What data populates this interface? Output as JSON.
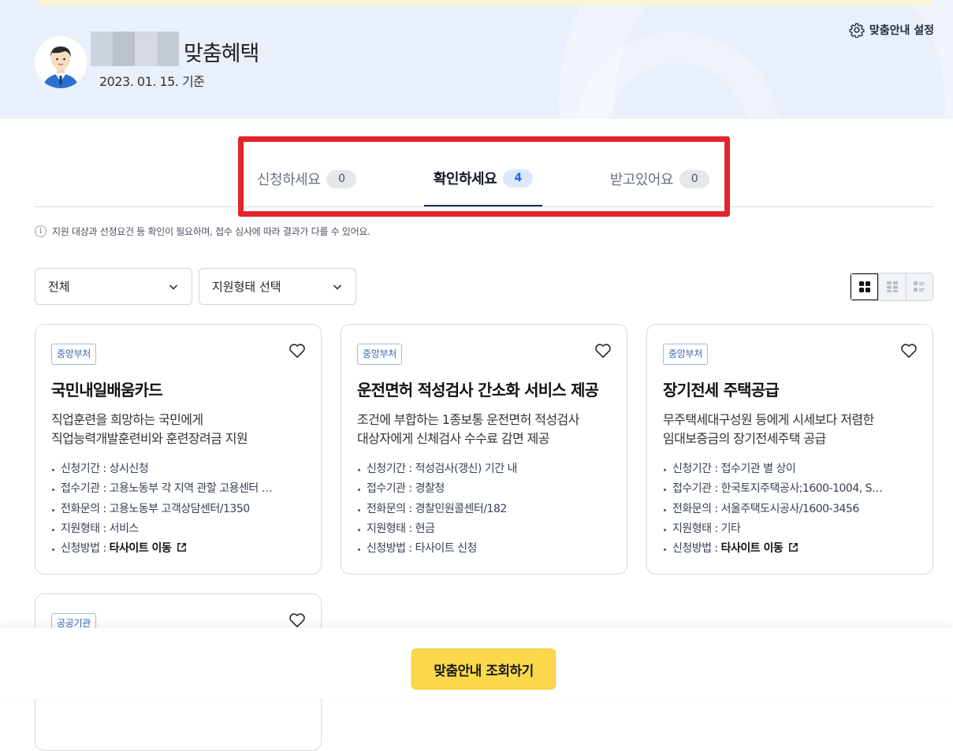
{
  "header": {
    "title": "맞춤혜택",
    "date": "2023. 01. 15. 기준",
    "settings_label": "맞춤안내 설정"
  },
  "tabs": [
    {
      "label": "신청하세요",
      "count": "0"
    },
    {
      "label": "확인하세요",
      "count": "4"
    },
    {
      "label": "받고있어요",
      "count": "0"
    }
  ],
  "active_tab": "확인하세요",
  "info_text": "지원 대상과 선정요건 등 확인이 필요하며, 접수 심사에 따라 결과가 다를 수 있어요.",
  "filters": {
    "category": "전체",
    "support_type": "지원형태 선택"
  },
  "view_modes": [
    "grid-4",
    "grid-list",
    "list"
  ],
  "cards": [
    {
      "badge": "중앙부처",
      "title": "국민내일배움카드",
      "desc": "직업훈련을 희망하는 국민에게\n직업능력개발훈련비와 훈련장려금 지원",
      "items": [
        {
          "label": "신청기간",
          "value": "상시신청"
        },
        {
          "label": "접수기관",
          "value": "고용노동부 각 지역 관할 고용센터 …"
        },
        {
          "label": "전화문의",
          "value": "고용노동부 고객상담센터/1350"
        },
        {
          "label": "지원형태",
          "value": "서비스"
        },
        {
          "label": "신청방법",
          "value": "타사이트 이동"
        }
      ]
    },
    {
      "badge": "중앙부처",
      "title": "운전면허 적성검사 간소화 서비스 제공",
      "desc": "조건에 부합하는 1종보통 운전면허 적성검사\n대상자에게 신체검사 수수료 감면 제공",
      "items": [
        {
          "label": "신청기간",
          "value": "적성검사(갱신) 기간 내"
        },
        {
          "label": "접수기관",
          "value": "경찰청"
        },
        {
          "label": "전화문의",
          "value": "경찰민원콜센터/182"
        },
        {
          "label": "지원형태",
          "value": "현금"
        },
        {
          "label": "신청방법",
          "value": "타사이트 신청"
        }
      ]
    },
    {
      "badge": "중앙부처",
      "title": "장기전세 주택공급",
      "desc": "무주택세대구성원 등에게 시세보다 저렴한\n임대보증금의 장기전세주택 공급",
      "items": [
        {
          "label": "신청기간",
          "value": "접수기관 별 상이"
        },
        {
          "label": "접수기관",
          "value": "한국토지주택공사;1600-1004, S…"
        },
        {
          "label": "전화문의",
          "value": "서울주택도시공사/1600-3456"
        },
        {
          "label": "지원형태",
          "value": "기타"
        },
        {
          "label": "신청방법",
          "value": "타사이트 이동"
        }
      ]
    },
    {
      "badge": "공공기관"
    }
  ],
  "cta_label": "맞춤안내 조회하기",
  "colors": {
    "hero_bg": "#e9f0fb",
    "highlight": "#e3242b",
    "cta": "#fcd94a",
    "badge_text": "#3565b4"
  }
}
